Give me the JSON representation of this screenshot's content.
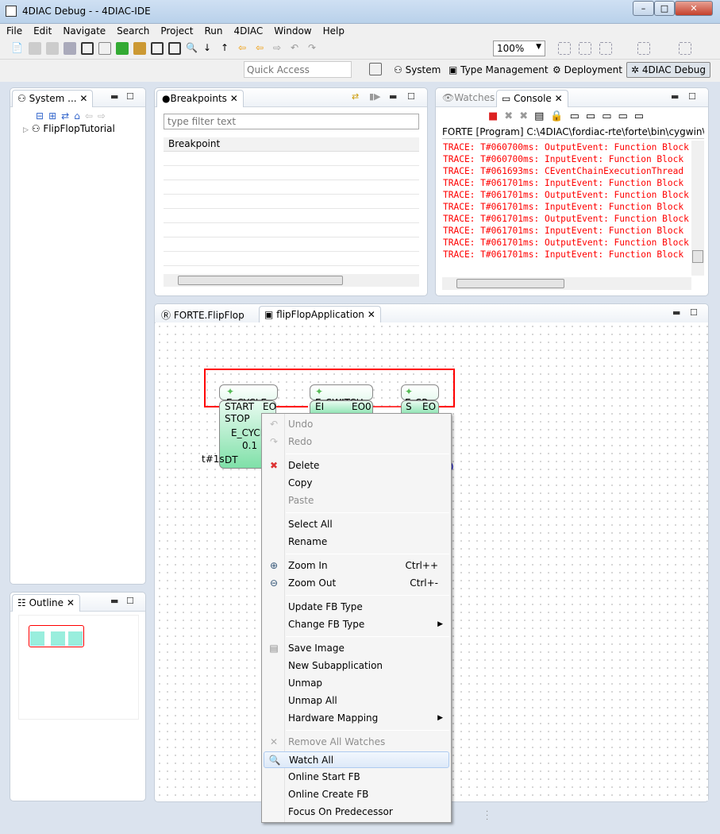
{
  "window": {
    "title": "4DIAC Debug -  - 4DIAC-IDE"
  },
  "menubar": [
    "File",
    "Edit",
    "Navigate",
    "Search",
    "Project",
    "Run",
    "4DIAC",
    "Window",
    "Help"
  ],
  "toolbar": {
    "zoom": "100%"
  },
  "quick_access": {
    "placeholder": "Quick Access"
  },
  "perspectives": [
    "System",
    "Type Management",
    "Deployment",
    "4DIAC Debug"
  ],
  "system_explorer": {
    "tab": "System ...",
    "tree": [
      "FlipFlopTutorial"
    ]
  },
  "outline": {
    "tab": "Outline"
  },
  "breakpoints": {
    "tab": "Breakpoints",
    "filter_placeholder": "type filter text",
    "column": "Breakpoint"
  },
  "console": {
    "tabs": [
      "Watches",
      "Console"
    ],
    "header": "FORTE [Program] C:\\4DIAC\\fordiac-rte\\forte\\bin\\cygwin\\src\\fo",
    "lines": [
      "TRACE: T#060700ms: OutputEvent: Function Block",
      "TRACE: T#060700ms: InputEvent: Function Block",
      "TRACE: T#061693ms: CEventChainExecutionThread",
      "TRACE: T#061701ms: InputEvent: Function Block",
      "TRACE: T#061701ms: OutputEvent: Function Block",
      "TRACE: T#061701ms: InputEvent: Function Block",
      "TRACE: T#061701ms: OutputEvent: Function Block",
      "TRACE: T#061701ms: InputEvent: Function Block",
      "TRACE: T#061701ms: OutputEvent: Function Block",
      "TRACE: T#061701ms: InputEvent: Function Block"
    ]
  },
  "editor": {
    "tabs": [
      "FORTE.FlipFlop",
      "flipFlopApplication"
    ],
    "blocks": {
      "cycle": {
        "name": "E_CYCLE",
        "type": "E_CYCLE",
        "version": "0.1",
        "in1": "START",
        "in2": "STOP",
        "out": "EO",
        "data_in": "DT",
        "param": "t#1s"
      },
      "switch": {
        "name": "E_SWITCH",
        "in": "EI",
        "out": "EO0"
      },
      "sr": {
        "name": "E_SR",
        "in": "S",
        "out": "EO"
      }
    }
  },
  "context_menu": [
    {
      "label": "Undo",
      "disabled": true,
      "icon": "undo-icon"
    },
    {
      "label": "Redo",
      "disabled": true,
      "icon": "redo-icon"
    },
    {
      "sep": true
    },
    {
      "label": "Delete",
      "icon": "delete-icon"
    },
    {
      "label": "Copy"
    },
    {
      "label": "Paste",
      "disabled": true
    },
    {
      "sep": true
    },
    {
      "label": "Select All"
    },
    {
      "label": "Rename"
    },
    {
      "sep": true
    },
    {
      "label": "Zoom In",
      "shortcut": "Ctrl++",
      "icon": "zoom-in-icon"
    },
    {
      "label": "Zoom Out",
      "shortcut": "Ctrl+-",
      "icon": "zoom-out-icon"
    },
    {
      "sep": true
    },
    {
      "label": "Update FB Type"
    },
    {
      "label": "Change FB Type",
      "submenu": true
    },
    {
      "sep": true
    },
    {
      "label": "Save Image",
      "icon": "save-image-icon"
    },
    {
      "label": "New Subapplication"
    },
    {
      "label": "Unmap"
    },
    {
      "label": "Unmap All"
    },
    {
      "label": "Hardware Mapping",
      "submenu": true
    },
    {
      "sep": true
    },
    {
      "label": "Remove All Watches",
      "disabled": true,
      "icon": "remove-watches-icon"
    },
    {
      "label": "Watch All",
      "highlighted": true,
      "icon": "watch-icon"
    },
    {
      "label": "Online Start FB"
    },
    {
      "label": "Online Create FB"
    },
    {
      "label": "Focus On Predecessor"
    }
  ]
}
